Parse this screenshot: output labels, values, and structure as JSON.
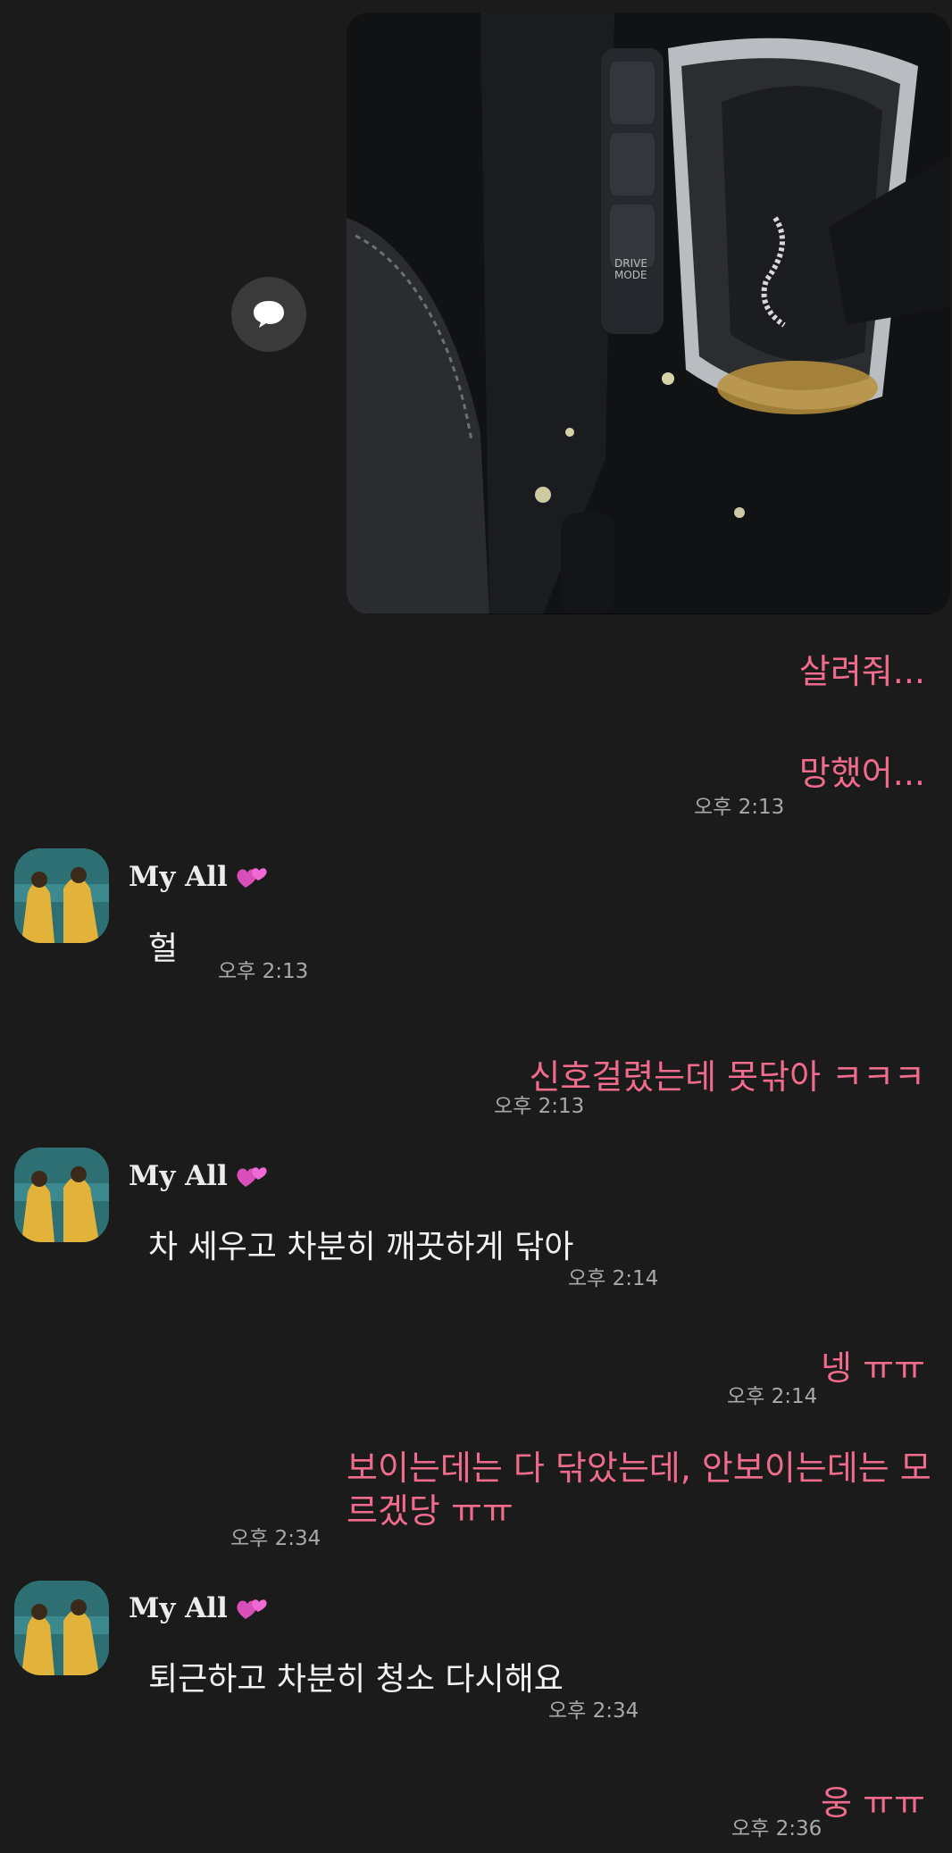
{
  "chat": {
    "photo": {
      "description_icon": "car-interior-photo"
    },
    "share_icon": "speech-bubble-icon",
    "messages": [
      {
        "side": "out",
        "text": "살려줘..."
      },
      {
        "side": "out",
        "text": "망했어...",
        "time": "오후 2:13"
      },
      {
        "side": "in",
        "sender": "My All",
        "text": "헐",
        "time": "오후 2:13"
      },
      {
        "side": "out",
        "text": "신호걸렸는데 못닦아 ㅋㅋㅋ",
        "time": "오후 2:13"
      },
      {
        "side": "in",
        "sender": "My All",
        "text": "차 세우고 차분히 깨끗하게 닦아",
        "time": "오후 2:14"
      },
      {
        "side": "out",
        "text": "넹 ㅠㅠ",
        "time": "오후 2:14"
      },
      {
        "side": "out",
        "text": "보이는데는 다 닦았는데, 안보이는데는 모르겠당 ㅠㅠ",
        "time": "오후 2:34"
      },
      {
        "side": "in",
        "sender": "My All",
        "text": "퇴근하고 차분히 청소 다시해요",
        "time": "오후 2:34"
      },
      {
        "side": "out",
        "text": "웅 ㅠㅠ",
        "time": "오후 2:36"
      }
    ]
  },
  "colors": {
    "background": "#1b1b1b",
    "outgoing_text": "#f16b8d",
    "incoming_text": "#f2f2f2",
    "timestamp": "#a9a9a9",
    "heart": "#e64fc4"
  }
}
